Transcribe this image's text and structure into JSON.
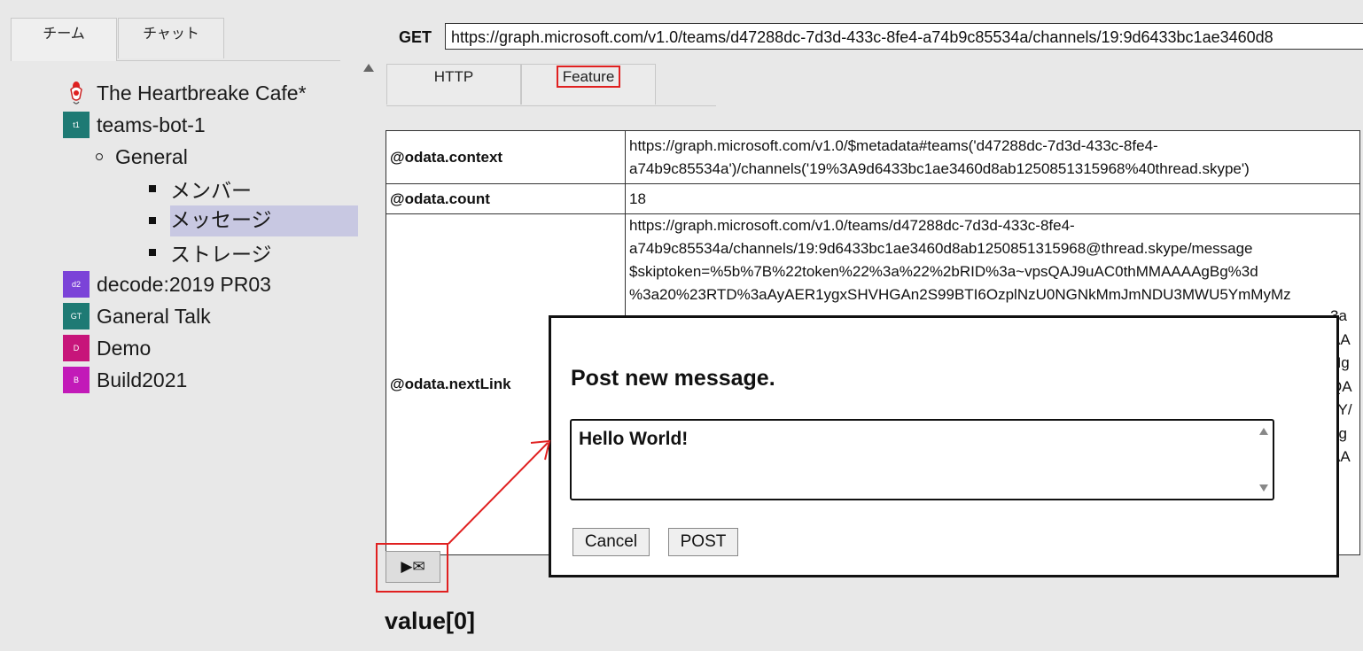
{
  "left_tabs": [
    "チーム",
    "チャット"
  ],
  "tree": {
    "cafe": "The Heartbreake Cafe*",
    "team1": {
      "label": "teams-bot-1",
      "icon_text": "t1",
      "color": "#1e7a74"
    },
    "channel": "General",
    "sub_items": [
      "メンバー",
      "メッセージ",
      "ストレージ"
    ],
    "selected": "メッセージ",
    "teams": [
      {
        "label": "decode:2019 PR03",
        "icon_text": "d2",
        "color": "#7b43d8"
      },
      {
        "label": "Ganeral Talk",
        "icon_text": "GT",
        "color": "#1e7a74"
      },
      {
        "label": "Demo",
        "icon_text": "D",
        "color": "#c7157a"
      },
      {
        "label": "Build2021",
        "icon_text": "B",
        "color": "#c21ab8"
      }
    ]
  },
  "request": {
    "method": "GET",
    "url": "https://graph.microsoft.com/v1.0/teams/d47288dc-7d3d-433c-8fe4-a74b9c85534a/channels/19:9d6433bc1ae3460d8"
  },
  "response_tabs": [
    "HTTP",
    "Feature"
  ],
  "table": {
    "context_key": "@odata.context",
    "context_lines": [
      "https://graph.microsoft.com/v1.0/$metadata#teams('d47288dc-7d3d-433c-8fe4-",
      "a74b9c85534a')/channels('19%3A9d6433bc1ae3460d8ab1250851315968%40thread.skype')"
    ],
    "count_key": "@odata.count",
    "count_value": "18",
    "next_key": "@odata.nextLink",
    "next_lines": [
      "https://graph.microsoft.com/v1.0/teams/d47288dc-7d3d-433c-8fe4-",
      "a74b9c85534a/channels/19:9d6433bc1ae3460d8ab1250851315968@thread.skype/message",
      "$skiptoken=%5b%7B%22token%22%3a%22%2bRID%3a~vpsQAJ9uAC0thMMAAAAgBg%3d",
      "%3a20%23RTD%3aAyAER1ygxSHVHGAn2S99BTI6OzplNzU0NGNkMmJmNDU3MWU5YmMyMz"
    ],
    "next_fragments": [
      "3a",
      "AA",
      "Hg",
      "QA",
      "JY/",
      "gg",
      "AA"
    ]
  },
  "action_button": "▶✉",
  "value_heading": "value[0]",
  "dialog": {
    "title": "Post new message.",
    "text": "Hello World!",
    "cancel": "Cancel",
    "post": "POST"
  },
  "accent_color": "#e02020"
}
